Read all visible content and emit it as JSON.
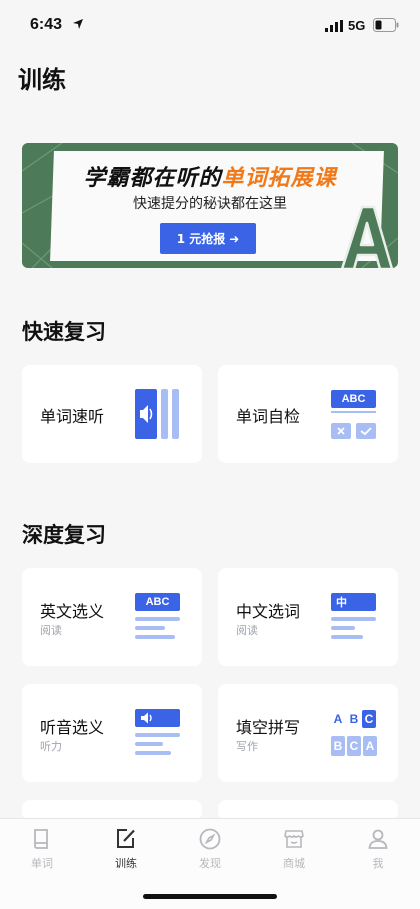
{
  "status_bar": {
    "time": "6:43",
    "network": "5G"
  },
  "page_title": "训练",
  "banner": {
    "headline_part1": "学霸都在听的",
    "headline_part2": "单词拓展课",
    "subtitle": "快速提分的秘诀都在这里",
    "cta_label": "1 元抢报",
    "cta_arrow": "➜",
    "accent_color": "#f07a1a",
    "button_color": "#3a63e6",
    "background_color": "#4d7a58"
  },
  "quick_review": {
    "title": "快速复习",
    "cards": [
      {
        "label": "单词速听",
        "icon": "audio-bars-illustration"
      },
      {
        "label": "单词自检",
        "icon": "abc-check-illustration",
        "badge": "ABC"
      }
    ]
  },
  "deep_review": {
    "title": "深度复习",
    "cards": [
      {
        "label": "英文选义",
        "sub": "阅读",
        "badge": "ABC"
      },
      {
        "label": "中文选词",
        "sub": "阅读",
        "badge": "中"
      },
      {
        "label": "听音选义",
        "sub": "听力"
      },
      {
        "label": "填空拼写",
        "sub": "写作",
        "letters": [
          "A",
          "B",
          "C",
          "B",
          "C",
          "A"
        ]
      }
    ]
  },
  "tab_bar": {
    "tabs": [
      {
        "label": "单词",
        "icon": "book-icon"
      },
      {
        "label": "训练",
        "icon": "edit-icon",
        "active": true
      },
      {
        "label": "发现",
        "icon": "compass-icon"
      },
      {
        "label": "商城",
        "icon": "store-icon"
      },
      {
        "label": "我",
        "icon": "profile-icon"
      }
    ]
  }
}
